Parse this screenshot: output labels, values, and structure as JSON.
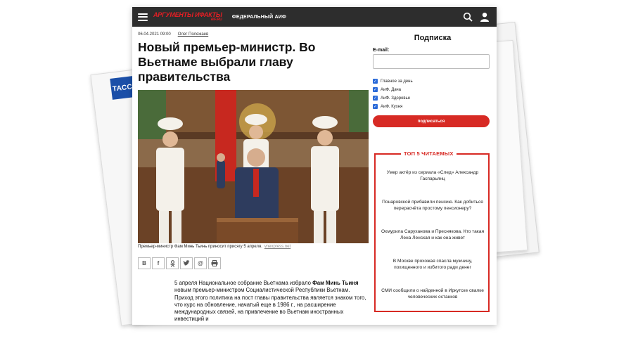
{
  "tass_logo": "ТАСС",
  "header": {
    "logo_main": "АРГУМЕНТЫ ИФАКТЫ",
    "logo_sub": "AIF.RU",
    "section": "ФЕДЕРАЛЬНЫЙ АИФ"
  },
  "article": {
    "date": "06.04.2021 09:00",
    "author": "Олег Полежаев",
    "headline": "Новый премьер-министр. Во Вьетнаме выбрали главу правительства",
    "caption": "Премьер-министр Фам Минь Тьинь приносит присягу 5 апреля.",
    "caption_source": "vnexpress.net",
    "body_start": "5 апреля Национальное собрание Вьетнама избрало ",
    "body_bold": "Фам Минь Тьиня",
    "body_rest": " новым премьер-министром Социалистической Республики Вьетнам. Приход этого политика на пост главы правительства является знаком того, что курс на обновление, начатый еще в 1986 г., на расширение международных связей, на привлечение во Вьетнам иностранных инвестиций и"
  },
  "share": [
    "В",
    "f",
    "ok",
    "tw",
    "@",
    "print"
  ],
  "sidebar": {
    "title": "Подписка",
    "email_label": "E-mail:",
    "email_value": "",
    "checkboxes": [
      "Главное за день",
      "АиФ. Дача",
      "АиФ. Здоровье",
      "АиФ. Кухня"
    ],
    "subscribe_label": "подписаться",
    "top5_title": "ТОП 5 ЧИТАЕМЫХ",
    "top5": [
      "Умер актёр из сериала «След» Александр Гаспарьянц",
      "Понаровской прибавили пенсию. Как добиться перерасчёта простому пенсионеру?",
      "Охмурила Саруханова и Преснякова. Кто такая Лена Ленская и как она живет",
      "В Москве прохожая спасла мужчину, похищенного и избитого ради денег",
      "СМИ сообщили о найденной в Иркутске свалке человеческих останков"
    ]
  },
  "colors": {
    "accent": "#d72a24",
    "topbar": "#2d2d2d",
    "check": "#2a6ad8"
  }
}
